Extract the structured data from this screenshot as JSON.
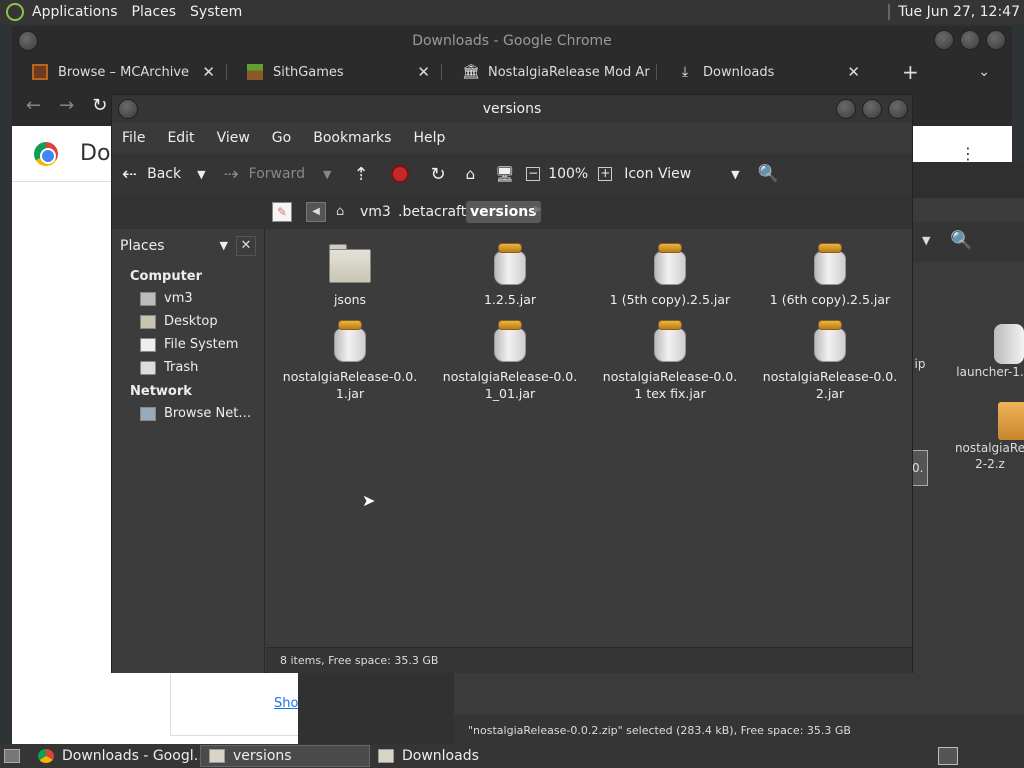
{
  "top_panel": {
    "menus": [
      "Applications",
      "Places",
      "System"
    ],
    "clock": "Tue Jun 27, 12:47"
  },
  "chrome": {
    "window_title": "Downloads - Google Chrome",
    "tabs": [
      {
        "label": "Browse – MCArchive",
        "icon": "mcarchive-icon"
      },
      {
        "label": "SithGames",
        "icon": "grass-block-icon"
      },
      {
        "label": "NostalgiaRelease Mod Ar",
        "icon": "archive-icon"
      },
      {
        "label": "Downloads",
        "icon": "download-icon"
      }
    ],
    "new_tab": "+",
    "page_title_partial": "Dov",
    "show_link_partial": "Sho"
  },
  "downloads_window": {
    "status": "\"nostalgiaRelease-0.0.2.zip\" selected (283.4 kB), Free space: 35.3 GB",
    "files": [
      {
        "label": "ip"
      },
      {
        "label": "launcher-1."
      },
      {
        "label": "0."
      },
      {
        "label": "nostalgiaRe 2-2.z"
      }
    ]
  },
  "versions_window": {
    "title": "versions",
    "menu": [
      "File",
      "Edit",
      "View",
      "Go",
      "Bookmarks",
      "Help"
    ],
    "toolbar": {
      "back": "Back",
      "forward": "Forward",
      "zoom": "100%",
      "view_mode": "Icon View"
    },
    "path": [
      "vm3",
      ".betacraft",
      "versions"
    ],
    "sidebar": {
      "selector": "Places",
      "sections": [
        {
          "title": "Computer",
          "items": [
            "vm3",
            "Desktop",
            "File System",
            "Trash"
          ]
        },
        {
          "title": "Network",
          "items": [
            "Browse Net…"
          ]
        }
      ]
    },
    "files": [
      {
        "line1": "jsons",
        "line2": "",
        "type": "folder"
      },
      {
        "line1": "1.2.5.jar",
        "line2": "",
        "type": "jar"
      },
      {
        "line1": "1 (5th copy).2.5.jar",
        "line2": "",
        "type": "jar"
      },
      {
        "line1": "1 (6th copy).2.5.jar",
        "line2": "",
        "type": "jar"
      },
      {
        "line1": "nostalgiaRelease-0.0.",
        "line2": "1.jar",
        "type": "jar"
      },
      {
        "line1": "nostalgiaRelease-0.0.",
        "line2": "1_01.jar",
        "type": "jar"
      },
      {
        "line1": "nostalgiaRelease-0.0.",
        "line2": "1 tex fix.jar",
        "type": "jar"
      },
      {
        "line1": "nostalgiaRelease-0.0.",
        "line2": "2.jar",
        "type": "jar"
      }
    ],
    "status": "8 items, Free space: 35.3 GB"
  },
  "taskbar": {
    "tasks": [
      {
        "label": "Downloads - Googl…",
        "icon": "chrome-icon"
      },
      {
        "label": "versions",
        "icon": "folder-icon",
        "active": true
      },
      {
        "label": "Downloads",
        "icon": "folder-icon"
      }
    ]
  }
}
